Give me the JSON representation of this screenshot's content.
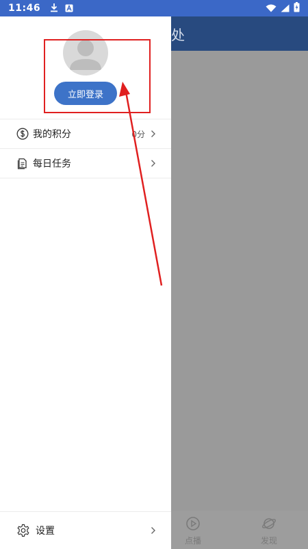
{
  "status_bar": {
    "time": "11:46",
    "background_color": "#3b68c7",
    "left_icons": [
      "download-icon",
      "notification-a-icon"
    ],
    "right_icons": [
      "wifi-icon",
      "cell-signal-icon",
      "battery-icon"
    ]
  },
  "background_app": {
    "title_visible": "处",
    "appbar_color": "#284a7f",
    "bottom_nav": [
      {
        "label": "点播",
        "icon": "play-circle-icon"
      },
      {
        "label": "发现",
        "icon": "planet-icon"
      }
    ]
  },
  "drawer": {
    "avatar_icon": "user-avatar-icon",
    "login_button": "立即登录",
    "accent_color": "#3d73c8",
    "menu_items": [
      {
        "label": "我的积分",
        "value": "0分",
        "icon": "dollar-circle-icon"
      },
      {
        "label": "每日任务",
        "value": "",
        "icon": "document-icon"
      }
    ],
    "settings": {
      "label": "设置",
      "icon": "gear-icon"
    }
  },
  "annotation": {
    "color": "#e02020",
    "shapes": [
      "highlight-box",
      "arrow"
    ]
  }
}
